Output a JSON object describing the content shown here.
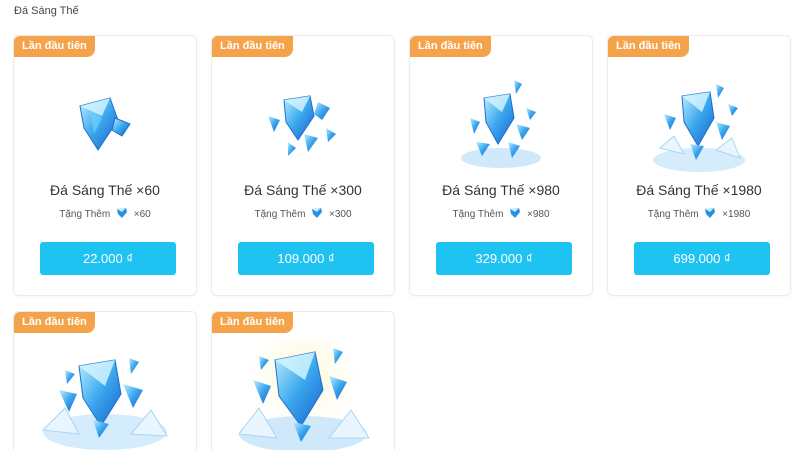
{
  "section": {
    "title": "Đá Sáng Thế"
  },
  "colors": {
    "badge": "#f4a34b",
    "button": "#1fc3f2",
    "gem_main": "#2b8fe0",
    "gem_light": "#8fd8ff"
  },
  "products": [
    {
      "badge": "Lần đầu tiên",
      "name": "Đá Sáng Thế ×60",
      "bonus_label": "Tặng Thêm",
      "bonus_amount": "×60",
      "price": "22.000 ₫",
      "icon": "crystal-icon"
    },
    {
      "badge": "Lần đầu tiên",
      "name": "Đá Sáng Thế ×300",
      "bonus_label": "Tặng Thêm",
      "bonus_amount": "×300",
      "price": "109.000 ₫",
      "icon": "crystal-icon"
    },
    {
      "badge": "Lần đầu tiên",
      "name": "Đá Sáng Thế ×980",
      "bonus_label": "Tặng Thêm",
      "bonus_amount": "×980",
      "price": "329.000 ₫",
      "icon": "crystal-icon"
    },
    {
      "badge": "Lần đầu tiên",
      "name": "Đá Sáng Thế ×1980",
      "bonus_label": "Tặng Thêm",
      "bonus_amount": "×1980",
      "price": "699.000 ₫",
      "icon": "crystal-icon"
    },
    {
      "badge": "Lần đầu tiên",
      "icon": "crystal-pile-icon"
    },
    {
      "badge": "Lần đầu tiên",
      "icon": "crystal-chest-icon"
    }
  ]
}
